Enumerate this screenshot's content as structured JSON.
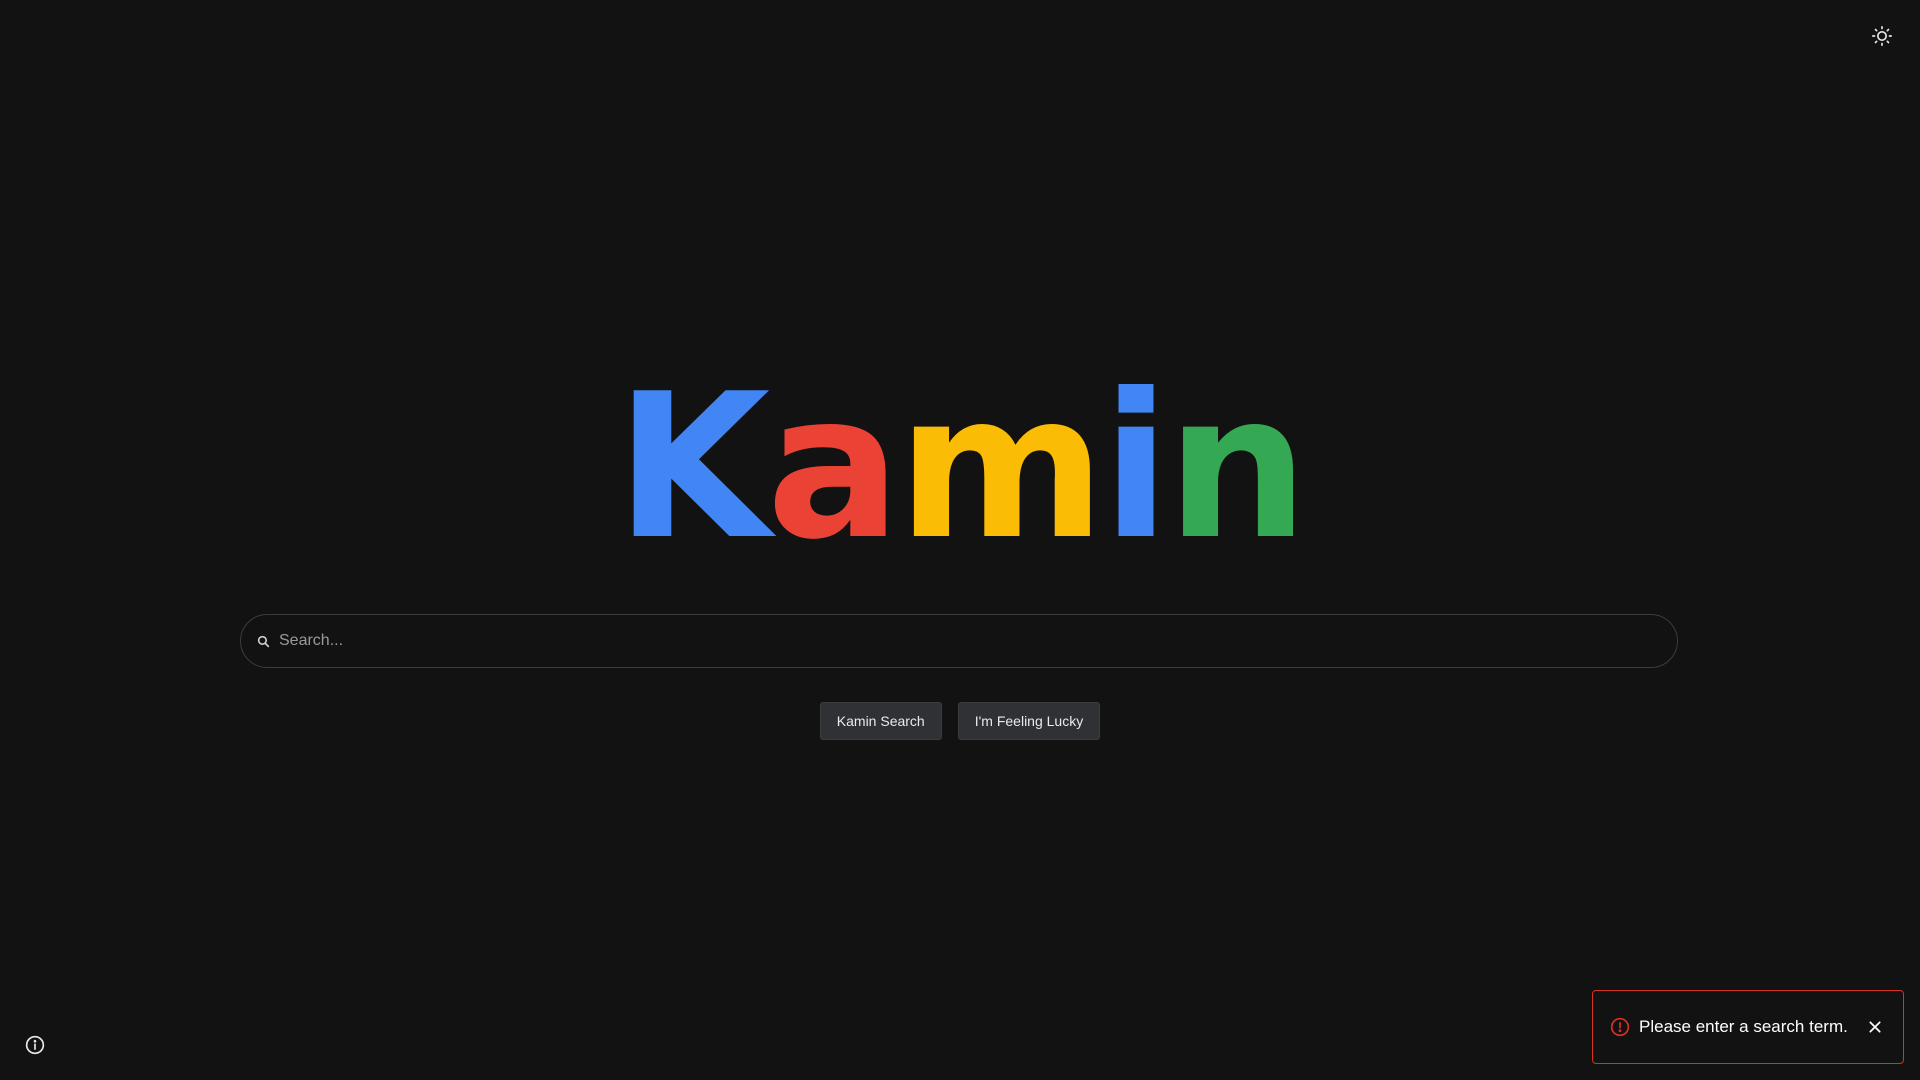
{
  "logo": {
    "letters": [
      {
        "char": "K",
        "color": "#4285f4"
      },
      {
        "char": "a",
        "color": "#ea4335"
      },
      {
        "char": "m",
        "color": "#fbbc05"
      },
      {
        "char": "i",
        "color": "#4285f4"
      },
      {
        "char": "n",
        "color": "#34a853"
      }
    ]
  },
  "search": {
    "placeholder": "Search...",
    "value": "",
    "icon": "search-icon"
  },
  "buttons": {
    "search_label": "Kamin Search",
    "lucky_label": "I'm Feeling Lucky"
  },
  "header": {
    "theme_icon": "sun-icon"
  },
  "footer": {
    "info_icon": "info-icon"
  },
  "toast": {
    "message": "Please enter a search term.",
    "icon": "alert-circle-icon",
    "close_icon": "close-icon",
    "color": "#d93025"
  },
  "colors": {
    "background": "#121212",
    "button_bg": "#303134",
    "border": "#3c3c3c"
  }
}
